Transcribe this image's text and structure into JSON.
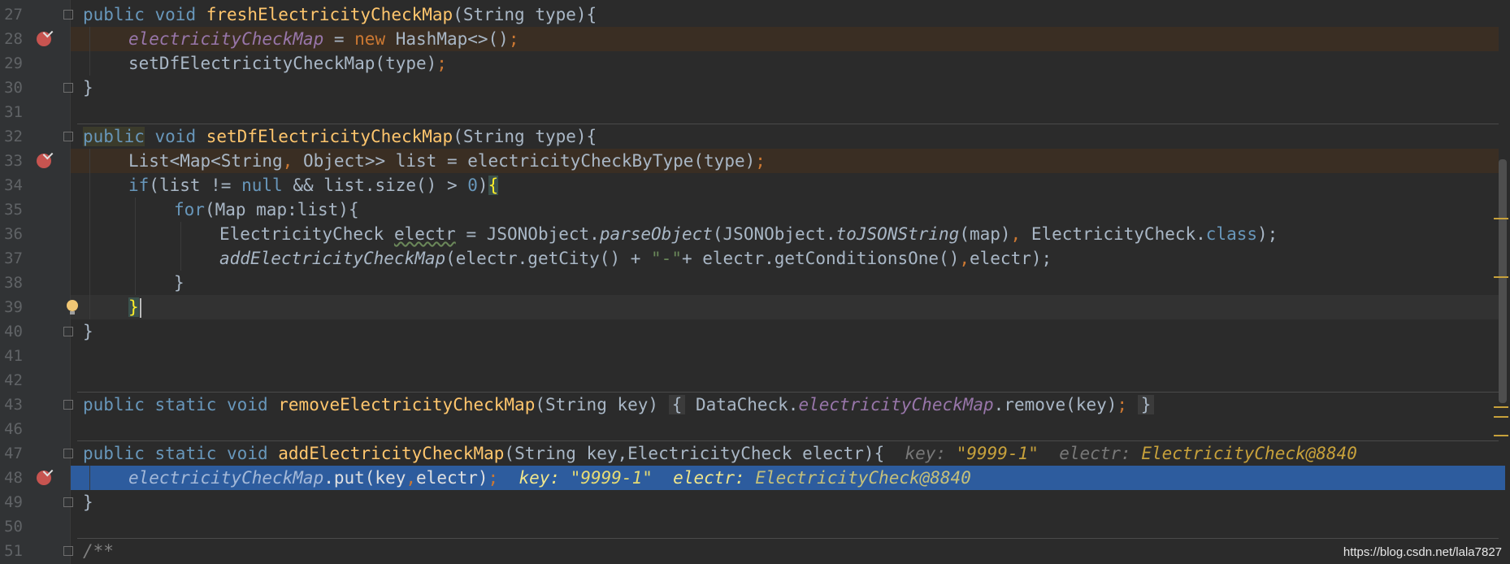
{
  "editor": {
    "lines": [
      {
        "n": "27"
      },
      {
        "n": "28"
      },
      {
        "n": "29"
      },
      {
        "n": "30"
      },
      {
        "n": "31"
      },
      {
        "n": "32"
      },
      {
        "n": "33"
      },
      {
        "n": "34"
      },
      {
        "n": "35"
      },
      {
        "n": "36"
      },
      {
        "n": "37"
      },
      {
        "n": "38"
      },
      {
        "n": "39"
      },
      {
        "n": "40"
      },
      {
        "n": "41"
      },
      {
        "n": "42"
      },
      {
        "n": "43"
      },
      {
        "n": "46"
      },
      {
        "n": "47"
      },
      {
        "n": "48"
      },
      {
        "n": "49"
      },
      {
        "n": "50"
      },
      {
        "n": "51"
      }
    ],
    "tokens": {
      "public": "public",
      "void": "void",
      "static": "static",
      "new": "new",
      "if": "if",
      "for": "for",
      "null": "null",
      "class_kw": "class",
      "fresh_fn": "freshElectricityCheckMap",
      "fresh_params": "(String type){",
      "map_field": "electricityCheckMap",
      "assign_new": " = ",
      "hashmap": "HashMap<>()",
      "semi": ";",
      "setdf_call": "setDfElectricityCheckMap(type)",
      "close_brace": "}",
      "setdf_fn": "setDfElectricityCheckMap",
      "list_decl": "List<Map<String",
      "comma": ",",
      "list_decl2": " Object>> list = electricityCheckByType(type)",
      "if_cond_a": "(list != ",
      "if_cond_b": " && list.size() > ",
      "zero": "0",
      "if_close": ")",
      "open_brace": "{",
      "for_body": "(Map map:list){",
      "ec_type": "ElectricityCheck ",
      "electr": "electr",
      "json_a": " = JSONObject.",
      "parse_obj": "parseObject",
      "json_b": "(JSONObject.",
      "to_json": "toJSONString",
      "json_c": "(map)",
      "json_d": " ElectricityCheck.",
      "json_end": ");",
      "add_fn_it": "addElectricityCheckMap",
      "add_args": "(electr.getCity() + ",
      "dash_str": "\"-\"",
      "add_args2": "+ electr.getConditionsOne()",
      "add_args3": "electr);",
      "remove_fn": "removeElectricityCheckMap",
      "remove_params": "(String key) ",
      "fold_open": "{",
      "remove_body_a": " DataCheck.",
      "remove_body_b": ".remove(key)",
      "fold_close": "}",
      "add_fn": "addElectricityCheckMap",
      "add_params": "(String key,ElectricityCheck electr){",
      "put_call": ".put(key",
      "put_call2": "electr)",
      "comment": "/**"
    },
    "hints": {
      "key_label": "key: ",
      "key_value": "\"9999-1\"",
      "electr_label": "electr: ",
      "electr_value": "ElectricityCheck@8840"
    },
    "colors": {
      "background": "#2b2b2b",
      "execution_line": "#2d5c9e",
      "breakpoint_line": "#3a2e23",
      "caret_line": "#323232",
      "breakpoint": "#c75450"
    }
  },
  "watermark": "https://blog.csdn.net/lala7827"
}
